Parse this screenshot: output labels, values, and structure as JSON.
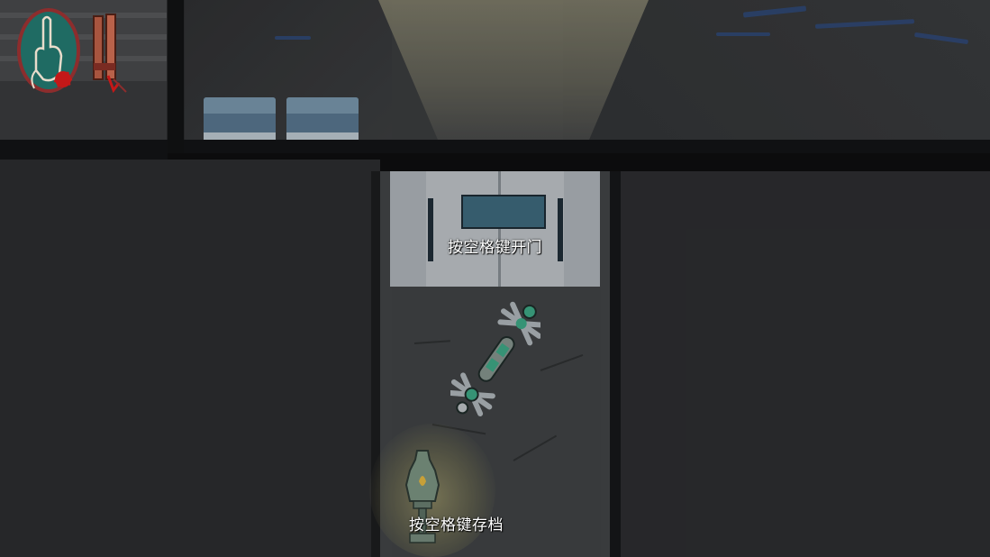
{
  "prompts": {
    "open_door": "按空格键开门",
    "save": "按空格键存档"
  },
  "hud": {
    "portrait_icon": "raised-finger-portrait-icon",
    "inventory_item_icon": "bundled-talisman-icon"
  },
  "colors": {
    "portrait_bg": "#1f6b63",
    "portrait_border": "#8c2d2d",
    "blood": "#c41818",
    "lantern_glow": "#d6cc86",
    "character_accent": "#3fb08a"
  }
}
